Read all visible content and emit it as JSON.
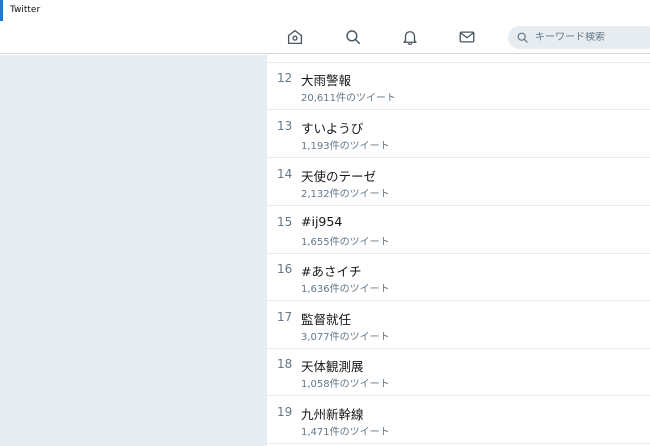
{
  "window": {
    "title": "Twitter"
  },
  "nav": {
    "icons": [
      "home-icon",
      "search-icon",
      "bell-icon",
      "mail-icon"
    ],
    "search_placeholder": "キーワード検索"
  },
  "trends": [
    {
      "rank": "12",
      "name": "大雨警報",
      "count": "20,611件のツイート"
    },
    {
      "rank": "13",
      "name": "すいようび",
      "count": "1,193件のツイート"
    },
    {
      "rank": "14",
      "name": "天使のテーゼ",
      "count": "2,132件のツイート"
    },
    {
      "rank": "15",
      "name": "#ij954",
      "count": "1,655件のツイート"
    },
    {
      "rank": "16",
      "name": "#あさイチ",
      "count": "1,636件のツイート"
    },
    {
      "rank": "17",
      "name": "監督就任",
      "count": "3,077件のツイート"
    },
    {
      "rank": "18",
      "name": "天体観測展",
      "count": "1,058件のツイート"
    },
    {
      "rank": "19",
      "name": "九州新幹線",
      "count": "1,471件のツイート"
    }
  ],
  "colors": {
    "accent": "#1c7bd6",
    "sidebar_bg": "#e6ecf0",
    "muted_text": "#657786",
    "main_text": "#14171a"
  }
}
